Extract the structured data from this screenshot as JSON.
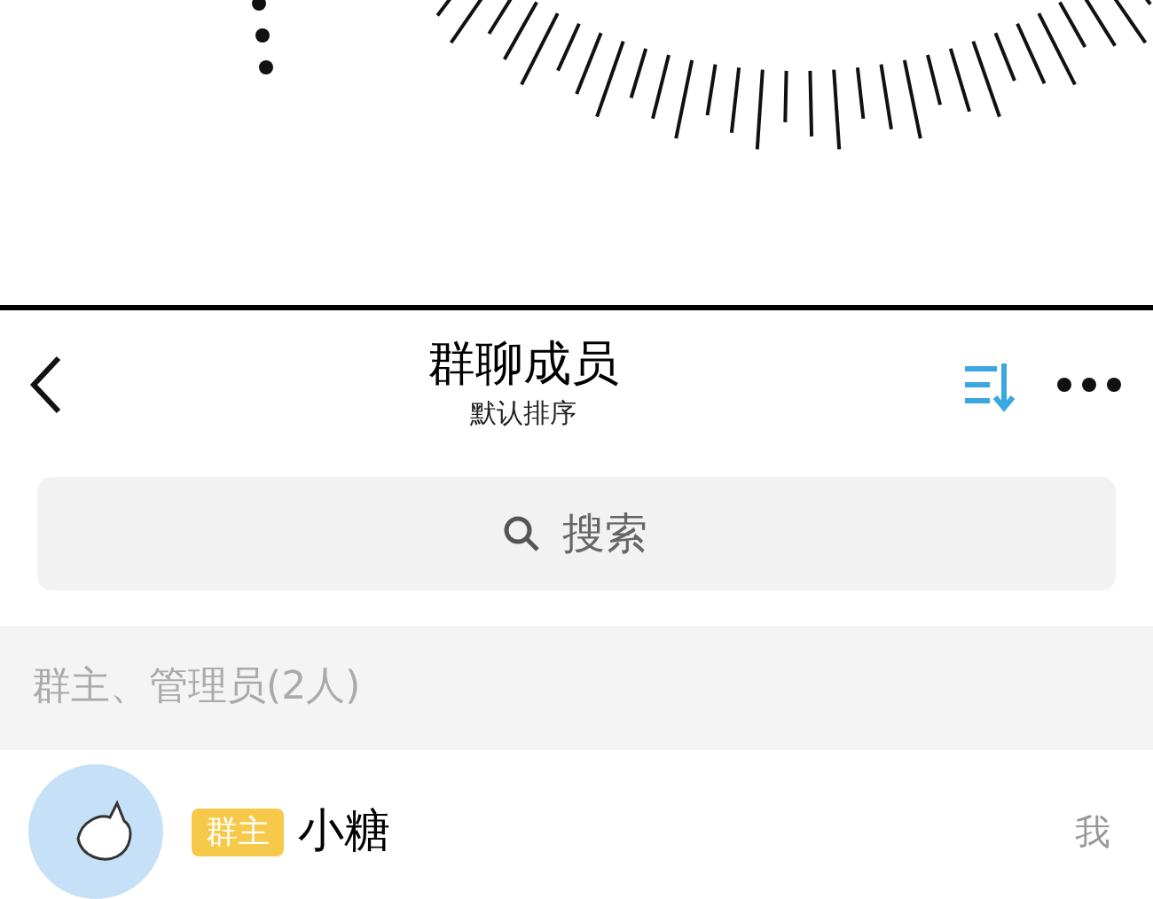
{
  "header": {
    "title": "群聊成员",
    "subtitle": "默认排序"
  },
  "search": {
    "placeholder": "搜索"
  },
  "section": {
    "title": "群主、管理员(2人)"
  },
  "members": [
    {
      "badge": "群主",
      "name": "小糖",
      "tag": "我"
    }
  ]
}
